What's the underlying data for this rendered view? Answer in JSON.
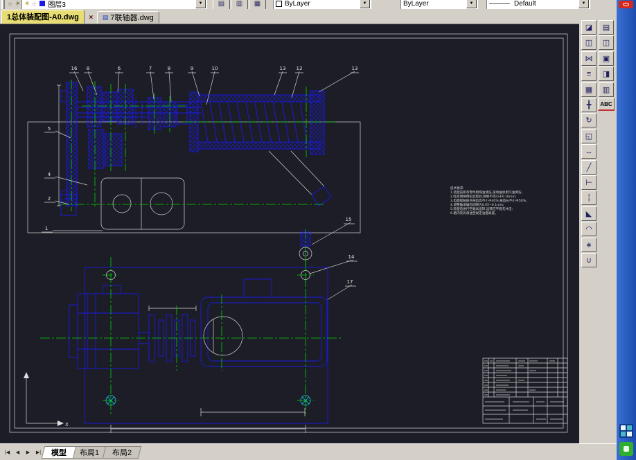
{
  "colors": {
    "accent_blue": "#1a1ae6",
    "centerline_green": "#00d400",
    "chrome_gray": "#d4d0c8",
    "active_tab_yellow": "#e7dd72",
    "strip_blue": "#2e66cf",
    "canvas_bg": "#1d1d27"
  },
  "top_toolbar": {
    "left_icons": [
      "☼",
      "☀"
    ],
    "layer": {
      "icon_on": "☀",
      "icon_freeze": "☼",
      "name": "图层3",
      "arrow": "▼"
    },
    "buttons": [
      {
        "glyph": "▤"
      },
      {
        "glyph": "▥"
      },
      {
        "glyph": "▦"
      }
    ],
    "color_control": {
      "value": "ByLayer",
      "arrow": "▼"
    },
    "linetype_control": {
      "value": "ByLayer",
      "arrow": "▼"
    },
    "lineweight_control": {
      "sample": "———",
      "value": "Default",
      "arrow": "▼"
    }
  },
  "file_tabs": {
    "active_label": "1总体装配图-A0.dwg",
    "close_glyph": "×",
    "inactive_icon": "▤",
    "inactive_label": "7联轴器.dwg"
  },
  "right_toolbar": {
    "col_a": [
      {
        "glyph": "◪"
      },
      {
        "glyph": "◫"
      },
      {
        "glyph": "⋈"
      },
      {
        "glyph": "≡"
      },
      {
        "glyph": "▦"
      },
      {
        "glyph": "╋"
      },
      {
        "glyph": "↻"
      },
      {
        "glyph": "◱"
      },
      {
        "glyph": "↔"
      },
      {
        "glyph": "╱"
      },
      {
        "glyph": "⊢"
      },
      {
        "glyph": "╎"
      },
      {
        "glyph": "◣"
      },
      {
        "glyph": "◠"
      },
      {
        "glyph": "∗"
      },
      {
        "glyph": "∪"
      }
    ],
    "col_b": [
      {
        "glyph": "▤"
      },
      {
        "glyph": "◫"
      },
      {
        "glyph": "▣"
      },
      {
        "glyph": "◨"
      },
      {
        "glyph": "▥"
      }
    ],
    "spell_button": "ABC"
  },
  "nav_buttons": {
    "first": "|◀",
    "prev": "◀",
    "next": "▶",
    "last": "▶|"
  },
  "layout_tabs": {
    "model": "模型",
    "layout1": "布局1",
    "layout2": "布局2"
  },
  "drawing": {
    "callouts": [
      "16",
      "8",
      "6",
      "7",
      "8",
      "9",
      "10",
      "13",
      "12",
      "13",
      "5",
      "4",
      "2",
      "1",
      "15",
      "14",
      "17"
    ],
    "ucs_x_label": "X",
    "notes": [
      "技术要求:",
      "1.装配前所有零件用煤油清洗,滚动轴承用汽油清洗;",
      "2.啮合侧隙用铅丝检验,侧隙不得小于0.16mm;",
      "3.齿面接触斑点按齿高不小于40%,按齿长不小于50%;",
      "4.调整轴承轴向间隙为0.05~0.1mm;",
      "5.装配后进行空载试运转,运转应平稳无冲击;",
      "6.箱内装润滑油至规定油面高度。"
    ]
  }
}
